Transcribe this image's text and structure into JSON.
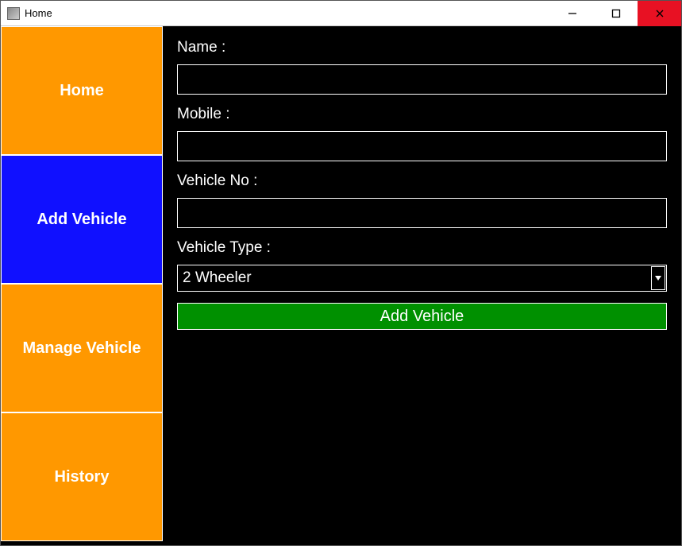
{
  "window": {
    "title": "Home"
  },
  "sidebar": {
    "items": [
      {
        "label": "Home",
        "active": false
      },
      {
        "label": "Add Vehicle",
        "active": true
      },
      {
        "label": "Manage Vehicle",
        "active": false
      },
      {
        "label": "History",
        "active": false
      }
    ]
  },
  "form": {
    "name_label": "Name :",
    "name_value": "",
    "mobile_label": "Mobile :",
    "mobile_value": "",
    "vehicleno_label": "Vehicle No :",
    "vehicleno_value": "",
    "vehicletype_label": "Vehicle Type :",
    "vehicletype_selected": "2 Wheeler",
    "submit_label": "Add Vehicle"
  }
}
